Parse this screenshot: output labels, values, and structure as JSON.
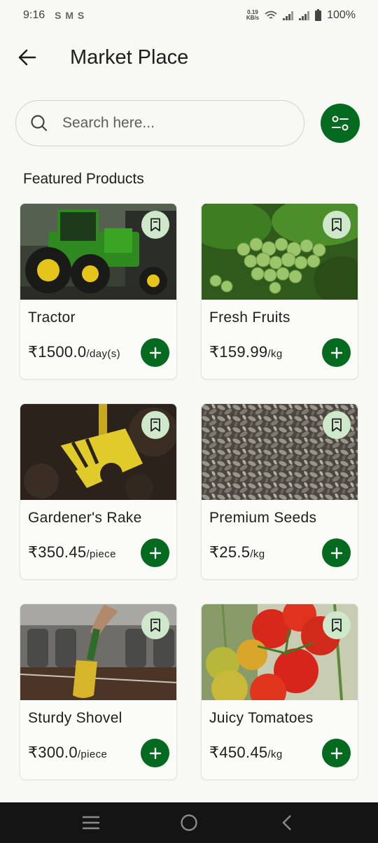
{
  "status_bar": {
    "time": "9:16",
    "notification_glyphs": "S M S",
    "net_speed_value": "0.19",
    "net_speed_unit": "KB/s",
    "battery": "100%"
  },
  "header": {
    "title": "Market Place",
    "back_icon": "arrow-left-icon"
  },
  "search": {
    "placeholder": "Search here...",
    "value": ""
  },
  "section": {
    "title": "Featured Products"
  },
  "products": [
    {
      "name": "Tractor",
      "price": "₹1500.0",
      "unit": "/day(s)",
      "image": "tractor-image"
    },
    {
      "name": "Fresh Fruits",
      "price": "₹159.99",
      "unit": "/kg",
      "image": "grapes-image"
    },
    {
      "name": "Gardener's Rake",
      "price": "₹350.45",
      "unit": "/piece",
      "image": "rake-image"
    },
    {
      "name": "Premium Seeds",
      "price": "₹25.5",
      "unit": "/kg",
      "image": "seeds-image"
    },
    {
      "name": "Sturdy Shovel",
      "price": "₹300.0",
      "unit": "/piece",
      "image": "shovel-image"
    },
    {
      "name": "Juicy Tomatoes",
      "price": "₹450.45",
      "unit": "/kg",
      "image": "tomatoes-image"
    }
  ],
  "colors": {
    "accent": "#046a1f",
    "bookmark_bg": "#cfe8cc",
    "background": "#f8f9f4"
  }
}
